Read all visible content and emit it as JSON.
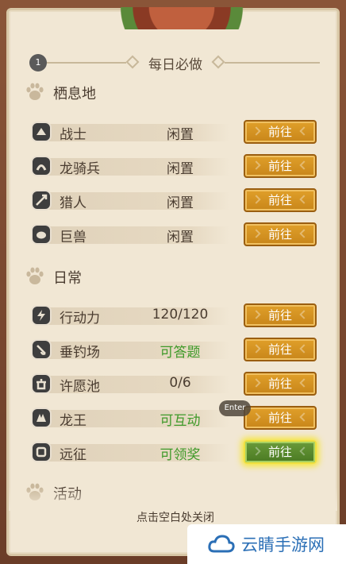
{
  "title": "每日必做",
  "badge": "1",
  "sections": [
    {
      "label": "栖息地",
      "rows": [
        {
          "name": "战士",
          "status": "闲置",
          "button": "前往",
          "icon": "warrior-icon"
        },
        {
          "name": "龙骑兵",
          "status": "闲置",
          "button": "前往",
          "icon": "dragon-rider-icon"
        },
        {
          "name": "猎人",
          "status": "闲置",
          "button": "前往",
          "icon": "hunter-icon"
        },
        {
          "name": "巨兽",
          "status": "闲置",
          "button": "前往",
          "icon": "beast-icon"
        }
      ]
    },
    {
      "label": "日常",
      "rows": [
        {
          "name": "行动力",
          "status": "120/120",
          "button": "前往",
          "icon": "stamina-icon"
        },
        {
          "name": "垂钓场",
          "status": "可答题",
          "button": "前往",
          "icon": "fishing-icon"
        },
        {
          "name": "许愿池",
          "status": "0/6",
          "button": "前往",
          "icon": "wishing-well-icon"
        },
        {
          "name": "龙王",
          "status": "可互动",
          "button": "前往",
          "icon": "dragon-king-icon"
        },
        {
          "name": "远征",
          "status": "可领奖",
          "button": "前往",
          "icon": "expedition-icon"
        }
      ]
    },
    {
      "label": "活动",
      "rows": []
    }
  ],
  "tooltip": "Enter",
  "close_hint": "点击空白处关闭",
  "watermark": "云睛手游网",
  "colors": {
    "button_gold": "#d8961f",
    "button_active": "#5a8a2e",
    "status_green": "#3f9a2a",
    "panel": "#f1e7d4"
  }
}
